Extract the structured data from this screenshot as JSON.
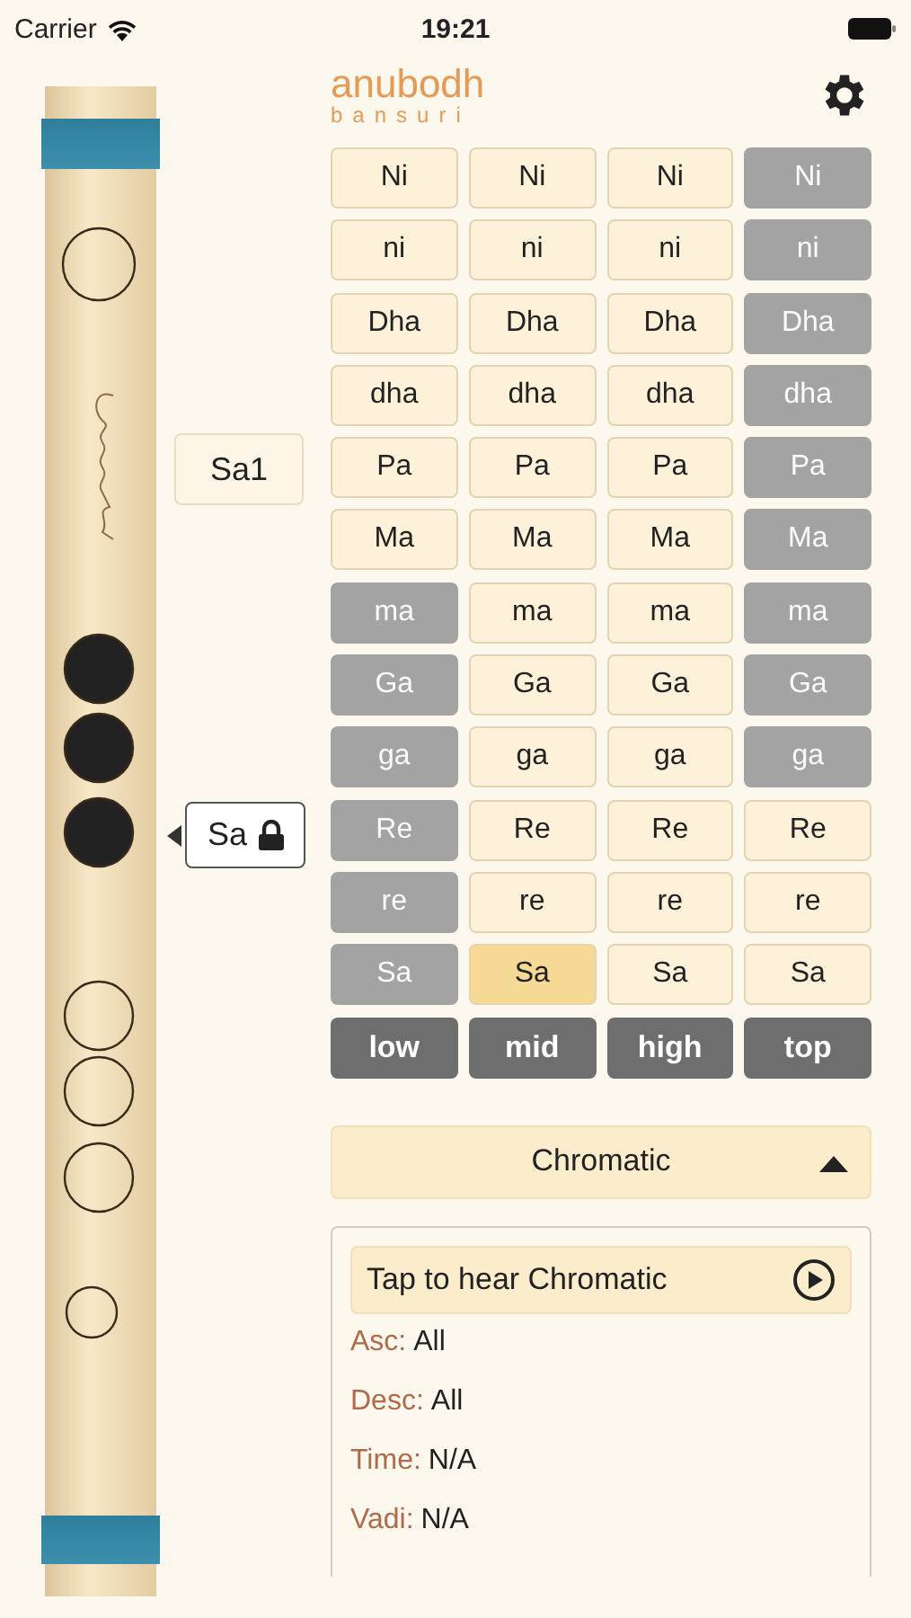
{
  "status_bar": {
    "carrier": "Carrier",
    "time": "19:21"
  },
  "logo": {
    "line_1": "anubodh",
    "line_2": "bansuri"
  },
  "flute": {
    "holes": [
      {
        "covered": false
      },
      {
        "covered": true
      },
      {
        "covered": true
      },
      {
        "covered": true
      },
      {
        "covered": false
      },
      {
        "covered": false
      },
      {
        "covered": false
      },
      {
        "covered": false
      }
    ],
    "upper_tag": "Sa1",
    "current_tag": {
      "label": "Sa",
      "locked": true
    }
  },
  "note_grid": {
    "rows": [
      {
        "cells": [
          {
            "label": "Ni",
            "disabled": false,
            "selected": false
          },
          {
            "label": "Ni",
            "disabled": false,
            "selected": false
          },
          {
            "label": "Ni",
            "disabled": false,
            "selected": false
          },
          {
            "label": "Ni",
            "disabled": true,
            "selected": false
          }
        ]
      },
      {
        "cells": [
          {
            "label": "ni",
            "disabled": false,
            "selected": false
          },
          {
            "label": "ni",
            "disabled": false,
            "selected": false
          },
          {
            "label": "ni",
            "disabled": false,
            "selected": false
          },
          {
            "label": "ni",
            "disabled": true,
            "selected": false
          }
        ]
      },
      {
        "cells": [
          {
            "label": "Dha",
            "disabled": false,
            "selected": false
          },
          {
            "label": "Dha",
            "disabled": false,
            "selected": false
          },
          {
            "label": "Dha",
            "disabled": false,
            "selected": false
          },
          {
            "label": "Dha",
            "disabled": true,
            "selected": false
          }
        ]
      },
      {
        "cells": [
          {
            "label": "dha",
            "disabled": false,
            "selected": false
          },
          {
            "label": "dha",
            "disabled": false,
            "selected": false
          },
          {
            "label": "dha",
            "disabled": false,
            "selected": false
          },
          {
            "label": "dha",
            "disabled": true,
            "selected": false
          }
        ]
      },
      {
        "cells": [
          {
            "label": "Pa",
            "disabled": false,
            "selected": false
          },
          {
            "label": "Pa",
            "disabled": false,
            "selected": false
          },
          {
            "label": "Pa",
            "disabled": false,
            "selected": false
          },
          {
            "label": "Pa",
            "disabled": true,
            "selected": false
          }
        ]
      },
      {
        "cells": [
          {
            "label": "Ma",
            "disabled": false,
            "selected": false
          },
          {
            "label": "Ma",
            "disabled": false,
            "selected": false
          },
          {
            "label": "Ma",
            "disabled": false,
            "selected": false
          },
          {
            "label": "Ma",
            "disabled": true,
            "selected": false
          }
        ]
      },
      {
        "cells": [
          {
            "label": "ma",
            "disabled": true,
            "selected": false
          },
          {
            "label": "ma",
            "disabled": false,
            "selected": false
          },
          {
            "label": "ma",
            "disabled": false,
            "selected": false
          },
          {
            "label": "ma",
            "disabled": true,
            "selected": false
          }
        ]
      },
      {
        "cells": [
          {
            "label": "Ga",
            "disabled": true,
            "selected": false
          },
          {
            "label": "Ga",
            "disabled": false,
            "selected": false
          },
          {
            "label": "Ga",
            "disabled": false,
            "selected": false
          },
          {
            "label": "Ga",
            "disabled": true,
            "selected": false
          }
        ]
      },
      {
        "cells": [
          {
            "label": "ga",
            "disabled": true,
            "selected": false
          },
          {
            "label": "ga",
            "disabled": false,
            "selected": false
          },
          {
            "label": "ga",
            "disabled": false,
            "selected": false
          },
          {
            "label": "ga",
            "disabled": true,
            "selected": false
          }
        ]
      },
      {
        "cells": [
          {
            "label": "Re",
            "disabled": true,
            "selected": false
          },
          {
            "label": "Re",
            "disabled": false,
            "selected": false
          },
          {
            "label": "Re",
            "disabled": false,
            "selected": false
          },
          {
            "label": "Re",
            "disabled": false,
            "selected": false
          }
        ]
      },
      {
        "cells": [
          {
            "label": "re",
            "disabled": true,
            "selected": false
          },
          {
            "label": "re",
            "disabled": false,
            "selected": false
          },
          {
            "label": "re",
            "disabled": false,
            "selected": false
          },
          {
            "label": "re",
            "disabled": false,
            "selected": false
          }
        ]
      },
      {
        "cells": [
          {
            "label": "Sa",
            "disabled": true,
            "selected": false
          },
          {
            "label": "Sa",
            "disabled": false,
            "selected": true
          },
          {
            "label": "Sa",
            "disabled": false,
            "selected": false
          },
          {
            "label": "Sa",
            "disabled": false,
            "selected": false
          }
        ]
      }
    ],
    "octaves": [
      "low",
      "mid",
      "high",
      "top"
    ]
  },
  "scale_dropdown": {
    "label": "Chromatic",
    "expanded": true
  },
  "scale_info": {
    "play_button": "Tap to hear Chromatic",
    "rows": [
      {
        "label": "Asc:",
        "value": "All"
      },
      {
        "label": "Desc:",
        "value": "All"
      },
      {
        "label": "Time:",
        "value": "N/A"
      },
      {
        "label": "Vadi:",
        "value": "N/A"
      }
    ]
  }
}
